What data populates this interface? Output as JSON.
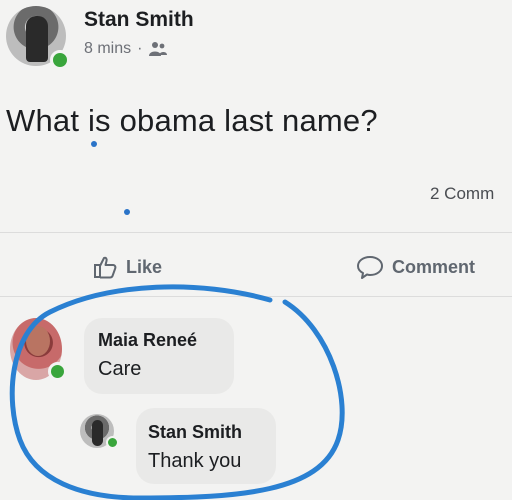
{
  "post": {
    "author": "Stan Smith",
    "time": "8 mins",
    "separator": "·",
    "privacy_icon": "friends-icon",
    "text": "What is obama last name?"
  },
  "stats": {
    "comments": "2 Comm"
  },
  "actions": {
    "like_label": "Like",
    "like_icon": "thumbs-up-icon",
    "comment_label": "Comment",
    "comment_icon": "speech-bubble-icon"
  },
  "comments": [
    {
      "author": "Maia Reneé",
      "text": "Care"
    },
    {
      "author": "Stan Smith",
      "text": "Thank you"
    }
  ],
  "colors": {
    "background": "#f3f3f2",
    "online": "#39a53c",
    "annotation": "#2a80d2",
    "bubble": "#e9e9e8"
  }
}
